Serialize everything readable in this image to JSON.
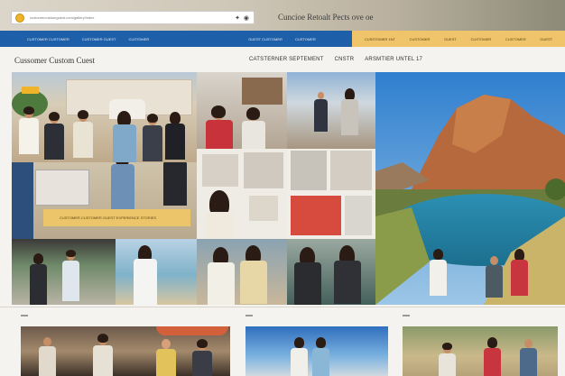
{
  "browser": {
    "url_text": "customercustomguest.com/gallery/index",
    "url_icons": "✦ ◉",
    "site_title": "Cuncioe Retoalt Pects ove oe"
  },
  "nav": {
    "left_items": [
      "CUSTOMER CUSTOMER",
      "CUSTOMER GUEST",
      "CUSTOMER",
      "GUEST CUSTOMER",
      "CUSTOMER"
    ],
    "right_items": [
      "CUSSTOMER 1NT",
      "CUSTOMER",
      "GUEST",
      "CUSTOMER",
      "CUSTOMER",
      "GUEST"
    ]
  },
  "page": {
    "title": "Cussomer Custom Cuest",
    "subnav": [
      "CATSTERNER SEPTEMENT",
      "CNSTR",
      "ARSMTIER UNTEL 17"
    ]
  },
  "collage": {
    "banner_text": "CUSTOMER CUSTOMER GUEST EXPERIENCE STORIES"
  },
  "colors": {
    "nav_blue": "#1d5fa8",
    "accent_gold": "#f0c46a"
  }
}
